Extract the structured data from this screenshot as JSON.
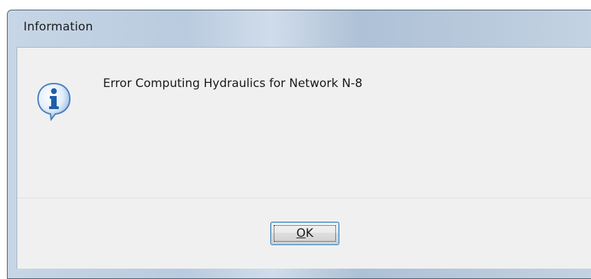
{
  "window": {
    "title": "Information"
  },
  "dialog": {
    "icon": "information-icon",
    "message": "Error Computing Hydraulics for Network N-8"
  },
  "buttons": {
    "ok_mnemonic": "O",
    "ok_rest": "K"
  },
  "colors": {
    "frame": "#b9cbdf",
    "client_background": "#f0f0f0",
    "button_border": "#3c7fb1",
    "icon_blue": "#2f6fb3"
  }
}
